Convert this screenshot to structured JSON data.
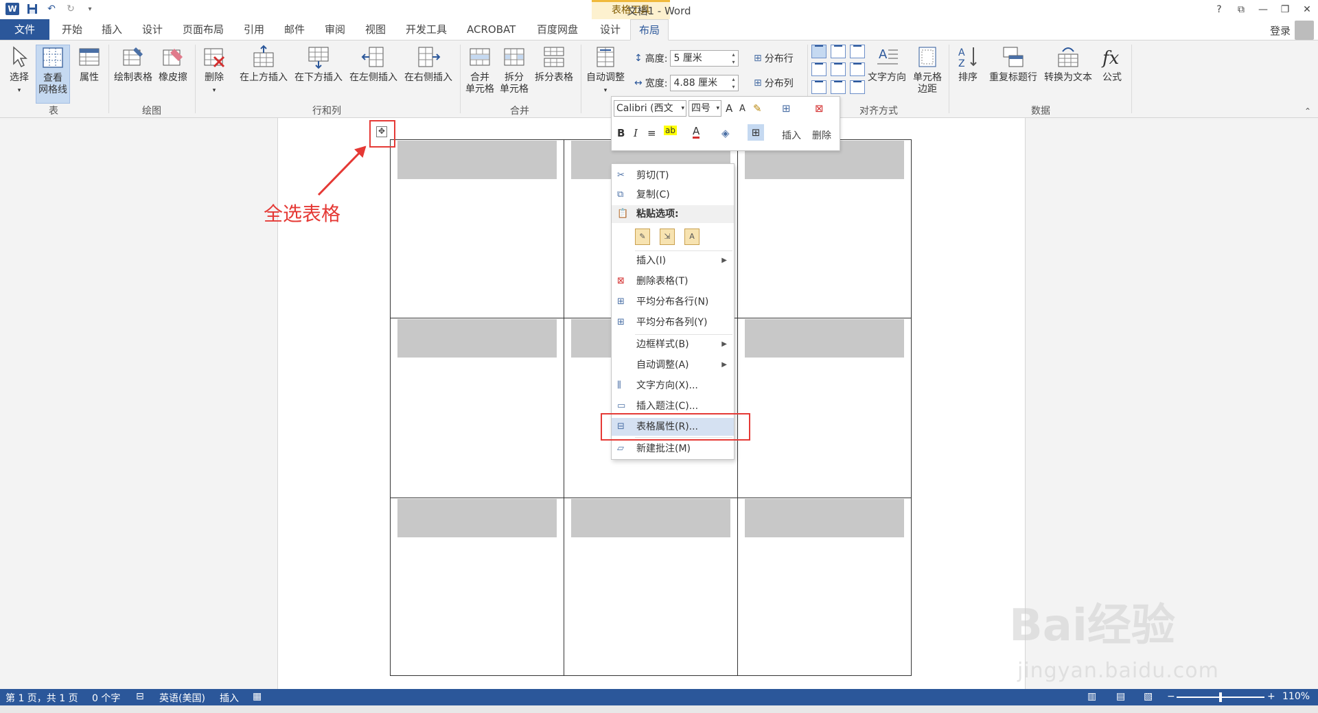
{
  "window": {
    "title": "文档1 - Word",
    "contextual_tab_group": "表格工具",
    "help": "?",
    "ribbon_display": "⧉",
    "minimize": "—",
    "restore": "❐",
    "close": "✕"
  },
  "qat": {
    "logo": "W",
    "save_icon": "save-icon",
    "undo_icon": "undo-icon",
    "redo_icon": "redo-icon",
    "customize_icon": "chevron-down-icon"
  },
  "tabs": [
    "文件",
    "开始",
    "插入",
    "设计",
    "页面布局",
    "引用",
    "邮件",
    "审阅",
    "视图",
    "开发工具",
    "ACROBAT",
    "百度网盘",
    "设计",
    "布局"
  ],
  "active_tab": "布局",
  "account": {
    "login": "登录"
  },
  "ribbon": {
    "table_group": {
      "select": "选择",
      "gridlines_1": "查看",
      "gridlines_2": "网格线",
      "properties": "属性",
      "label": "表"
    },
    "draw_group": {
      "draw_table": "绘制表格",
      "eraser": "橡皮擦",
      "label": "绘图"
    },
    "rows_cols_group": {
      "delete": "删除",
      "insert_above": "在上方插入",
      "insert_below": "在下方插入",
      "insert_left": "在左侧插入",
      "insert_right": "在右侧插入",
      "label": "行和列"
    },
    "merge_group": {
      "merge_1": "合并",
      "merge_2": "单元格",
      "split_1": "拆分",
      "split_2": "单元格",
      "split_table": "拆分表格",
      "label": "合并"
    },
    "cell_size_group": {
      "autofit": "自动调整",
      "height_label": "高度:",
      "height_value": "5 厘米",
      "width_label": "宽度:",
      "width_value": "4.88 厘米",
      "distribute_rows": "分布行",
      "distribute_cols": "分布列"
    },
    "alignment_group": {
      "text_direction": "文字方向",
      "margins_1": "单元格",
      "margins_2": "边距",
      "label": "对齐方式"
    },
    "data_group": {
      "sort": "排序",
      "repeat_header": "重复标题行",
      "convert_text": "转换为文本",
      "formula": "公式",
      "label": "数据"
    }
  },
  "mini_toolbar": {
    "font": "Calibri (西文",
    "size": "四号",
    "grow": "A",
    "shrink": "A",
    "bold": "B",
    "italic": "I",
    "insert": "插入",
    "delete": "删除"
  },
  "context_menu": {
    "cut": "剪切(T)",
    "copy": "复制(C)",
    "paste_options": "粘贴选项:",
    "insert": "插入(I)",
    "delete_table": "删除表格(T)",
    "distribute_rows": "平均分布各行(N)",
    "distribute_cols": "平均分布各列(Y)",
    "border_styles": "边框样式(B)",
    "autofit": "自动调整(A)",
    "text_direction": "文字方向(X)...",
    "insert_caption": "插入题注(C)...",
    "table_properties": "表格属性(R)...",
    "new_comment": "新建批注(M)"
  },
  "annotation": {
    "text": "全选表格",
    "color": "#e53935"
  },
  "statusbar": {
    "page": "第 1 页，共 1 页",
    "words": "0 个字",
    "language": "英语(美国)",
    "mode": "插入",
    "zoom": "110%",
    "zoom_minus": "−",
    "zoom_plus": "+"
  },
  "watermark": {
    "logo": "Bai经验",
    "url": "jingyan.baidu.com"
  },
  "colors": {
    "accent": "#2b579a",
    "contextual": "#f0b93b",
    "highlight_red": "#e53935"
  }
}
